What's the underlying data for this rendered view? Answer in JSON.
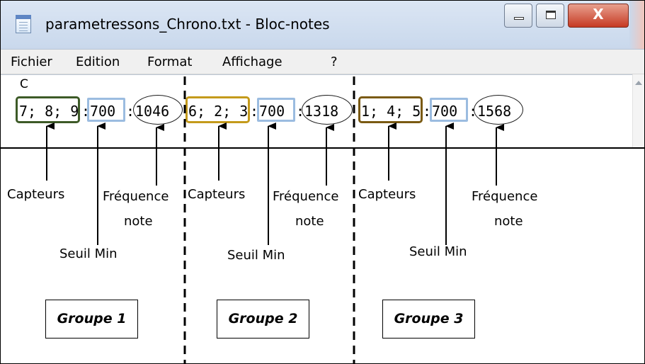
{
  "window": {
    "title": "parametressons_Chrono.txt - Bloc-notes",
    "close_glyph": "X"
  },
  "menu": [
    "Fichier",
    "Edition",
    "Format",
    "Affichage",
    "?"
  ],
  "editor": {
    "first_line": "C",
    "groups": [
      {
        "sensors": "7; 8; 9",
        "threshold": "700",
        "frequency": "1046"
      },
      {
        "sensors": "6; 2; 3",
        "threshold": "700",
        "frequency": "1318"
      },
      {
        "sensors": "1; 4; 5",
        "threshold": "700",
        "frequency": "1568"
      }
    ],
    "separator": ":"
  },
  "annotations": {
    "sensors": "Capteurs",
    "threshold": "Seuil Min",
    "frequency_line1": "Fréquence",
    "frequency_line2": "note"
  },
  "group_boxes": [
    "Groupe 1",
    "Groupe 2",
    "Groupe 3"
  ],
  "colors": {
    "group1_sensor_box": "#3d5a27",
    "group2_sensor_box": "#c49a1b",
    "group3_sensor_box": "#7a5a12",
    "threshold_box": "#9bbce0"
  }
}
